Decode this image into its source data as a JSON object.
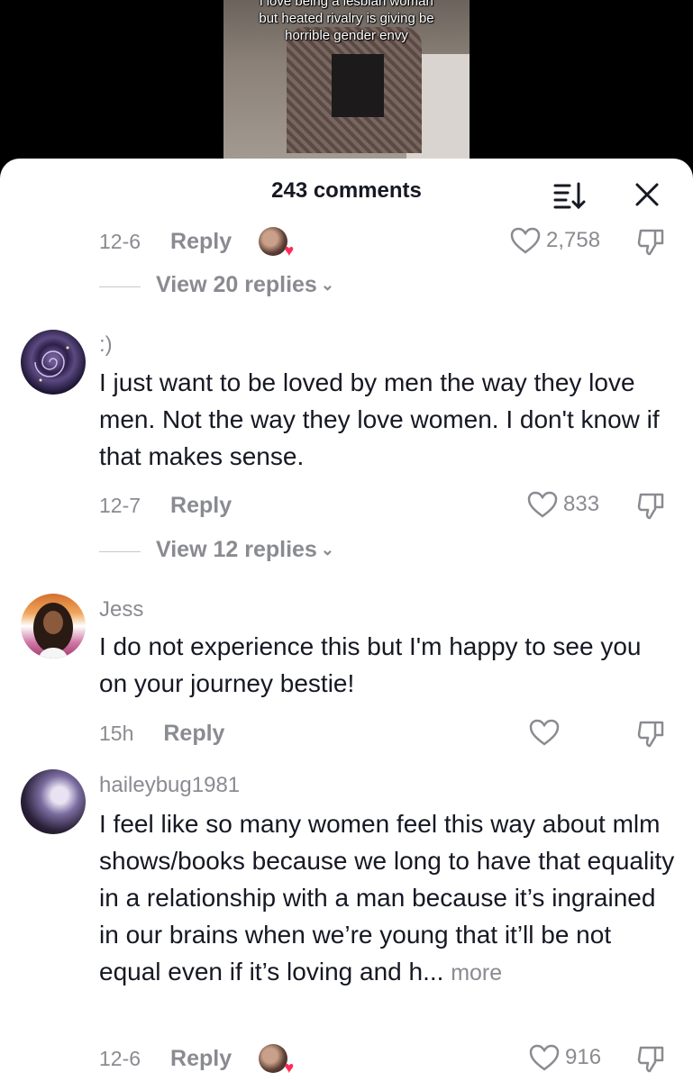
{
  "video": {
    "overlay_lines": [
      "i love being a lesbian woman",
      "but heated rivalry is giving be",
      "horrible gender envy"
    ]
  },
  "header": {
    "title": "243 comments",
    "sort_icon": "sort-icon",
    "close_icon": "close-icon"
  },
  "top_comment_meta": {
    "date": "12-6",
    "reply_label": "Reply",
    "creator_liked": true,
    "likes": "2,758",
    "view_replies": "View 20 replies"
  },
  "comments": [
    {
      "username": ":)",
      "text": "I just want to be loved by men the way they love men. Not the way they love women. I don't know if that makes sense.",
      "date": "12-7",
      "reply_label": "Reply",
      "likes": "833",
      "view_replies": "View 12 replies"
    },
    {
      "username": "Jess",
      "text": "I do not experience this but I'm happy to see you on your journey bestie!",
      "date": "15h",
      "reply_label": "Reply",
      "likes": ""
    },
    {
      "username": "haileybug1981",
      "text": "I feel like so many women feel this way about mlm shows/books because we long to have that equality in a relationship with a man because it’s ingrained in our brains when we’re young that it’ll be not equal even if it’s loving and h...",
      "more_label": "more",
      "date": "12-6",
      "reply_label": "Reply",
      "creator_liked": true,
      "likes": "916"
    }
  ],
  "colors": {
    "primary_text": "#161823",
    "secondary_text": "#8a8b91",
    "heart_accent": "#fe2c55",
    "sheet_bg": "#ffffff",
    "backdrop": "#000000"
  }
}
